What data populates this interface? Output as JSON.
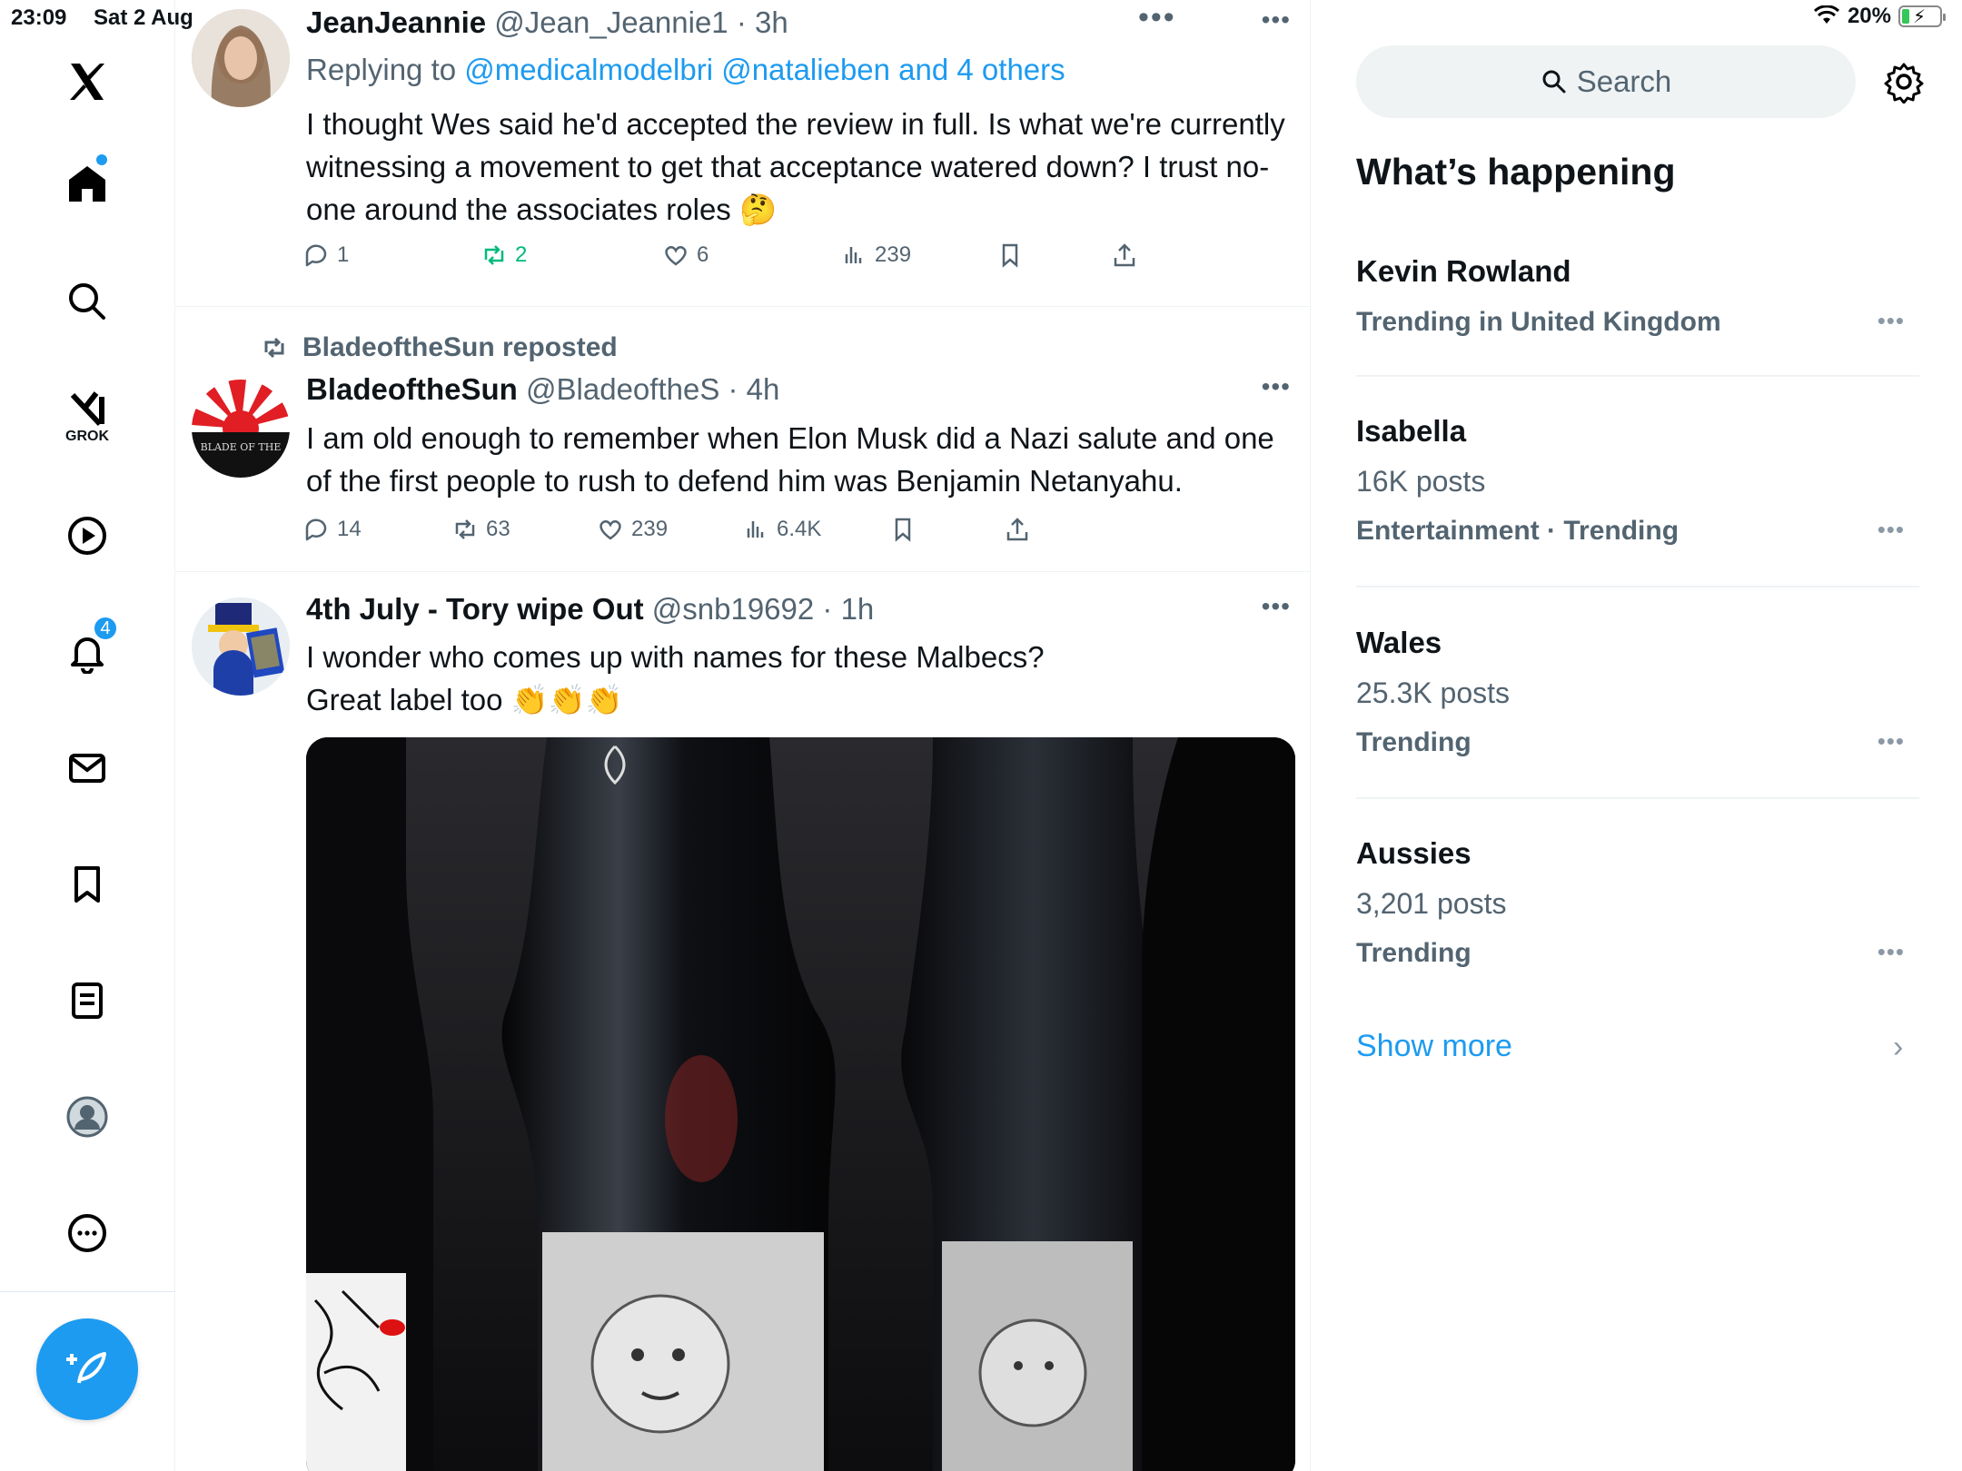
{
  "status": {
    "time": "23:09",
    "date": "Sat 2 Aug",
    "battery": "20%",
    "battery_level": 0.2
  },
  "nav": {
    "grok_label": "GROK",
    "notifications_badge": "4"
  },
  "feed": {
    "tweets": [
      {
        "name": "JeanJeannie",
        "handle": "@Jean_Jeannie1 · 3h",
        "reply_prefix": "Replying to ",
        "reply_targets": "@medicalmodelbri @natalieben and 4 others",
        "text": "I thought Wes said he'd accepted the review in full. Is what we're currently witnessing a movement to get that acceptance watered down? I trust no-one around the associates roles 🤔",
        "replies": "1",
        "reposts": "2",
        "likes": "6",
        "views": "239"
      },
      {
        "reposted_by": "BladeoftheSun reposted",
        "name": "BladeoftheSun",
        "handle": "@BladeoftheS · 4h",
        "avatar_text": "BLADE OF THE",
        "text": "I am old enough to remember when Elon Musk did a Nazi salute and one of the first people to rush to defend him was Benjamin Netanyahu.",
        "replies": "14",
        "reposts": "63",
        "likes": "239",
        "views": "6.4K"
      },
      {
        "name": "4th July - Tory wipe Out",
        "handle": "@snb19692 · 1h",
        "text_line1": "I wonder who comes up with names for these Malbecs?",
        "text_line2": "Great label too 👏👏👏"
      }
    ]
  },
  "sidebar": {
    "search_placeholder": "Search",
    "title": "What’s happening",
    "trends": [
      {
        "name": "Kevin Rowland",
        "count": "",
        "context": "Trending in United Kingdom"
      },
      {
        "name": "Isabella",
        "count": "16K posts",
        "context": "Entertainment · Trending"
      },
      {
        "name": "Wales",
        "count": "25.3K posts",
        "context": "Trending"
      },
      {
        "name": "Aussies",
        "count": "3,201 posts",
        "context": "Trending"
      }
    ],
    "show_more": "Show more"
  },
  "colors": {
    "accent": "#1d9bf0",
    "muted": "#536471",
    "repost_green": "#00ba7c"
  }
}
